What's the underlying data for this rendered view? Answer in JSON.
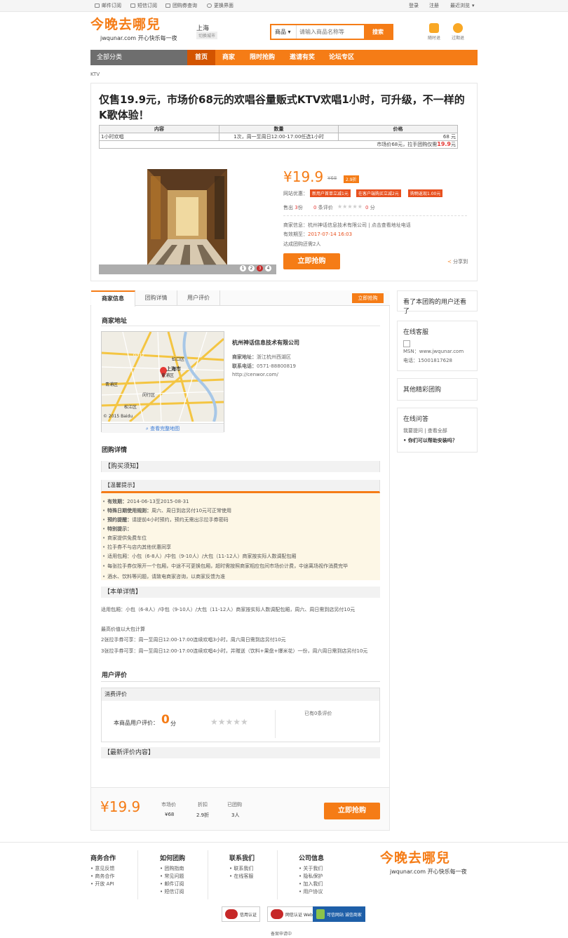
{
  "topbar": {
    "left": [
      "邮件订阅",
      "短信订阅",
      "团购券查询",
      "更换界面"
    ],
    "right": [
      "登录",
      "注册",
      "最近浏览"
    ]
  },
  "header": {
    "logo": "今晚去哪兒",
    "logo_sub": "jwqunar.com 开心快乐每一夜",
    "city": "上海",
    "switch_city": "切换城市",
    "search_select": "商品",
    "search_placeholder": "请输入商品名称等",
    "search_button": "搜索",
    "icon1": "随时退",
    "icon2": "过期退"
  },
  "nav": {
    "all": "全部分类",
    "items": [
      "首页",
      "商家",
      "限时抢购",
      "邀请有奖",
      "论坛专区"
    ]
  },
  "breadcrumb": "KTV",
  "deal": {
    "title": "仅售19.9元，市场价68元的欢唱谷量贩式KTV欢唱1小时，可升级，不一样的K歌体验！",
    "table": {
      "headers": [
        "内容",
        "数量",
        "价格"
      ],
      "row": [
        "1小时欢唱",
        "1次，周一至周日12:00-17:00任选1小时",
        "68 元"
      ],
      "summary_prefix": "市场价68元，拉手团购仅需",
      "summary_price": "19.9",
      "summary_unit": "元"
    },
    "slides": [
      "1",
      "2",
      "3",
      "4"
    ],
    "price": "¥19.9",
    "orig_price": "¥68",
    "discount": "2.9折",
    "promo_label": "网站优惠：",
    "promos": [
      "新用户首单立减1元",
      "在客户端购买立减2元",
      "购物返现1.00元"
    ],
    "sold_label": "售出",
    "sold": "3",
    "sold_unit": "份",
    "reviews": "0",
    "reviews_label": "条评价",
    "score": "0",
    "score_unit": "分",
    "merchant_label": "商家信息：",
    "merchant": "杭州神话信息技术有限公司 | 点击查看地址电话",
    "expire_label": "有效期至：",
    "expire": "2017-07-14 16:03",
    "reach": "达成团购还需2人",
    "buy": "立即抢购",
    "share": "分享到"
  },
  "tabs": [
    "商家信息",
    "团购详情",
    "用户评价"
  ],
  "tab_buy": "立即抢购",
  "merchant": {
    "section": "商家地址",
    "name": "杭州神话信息技术有限公司",
    "addr_label": "商家地址：",
    "addr": "浙江杭州西湖区",
    "tel_label": "联系电话：",
    "tel": "0571-88800819",
    "url": "http://cenwor.com/",
    "map_link": "查看完整地图",
    "map_copy": "© 2015 Baidu",
    "map_labels": [
      "虹口区",
      "上海市",
      "黄浦区",
      "青浦区",
      "闵行区",
      "松江区",
      "G312"
    ]
  },
  "details": {
    "section": "团购详情",
    "buy_notice": "【购买须知】",
    "tip": "【温馨提示】",
    "items": [
      [
        "有效期：",
        "2014-06-13至2015-08-31"
      ],
      [
        "特殊日期使用规则：",
        "周六、周日到店另付10元可正常使用"
      ],
      [
        "预约提醒：",
        "请提前4小时预约，预约无需出示拉手券密码"
      ],
      [
        "特别提示：",
        ""
      ],
      [
        "",
        "商家提供免费车位"
      ],
      [
        "",
        "拉手券不与店内其他优惠同享"
      ],
      [
        "",
        "适用包厢：小包（6-8人）/中包（9-10人）/大包（11-12人）商家按实际人数调配包厢"
      ],
      [
        "",
        "每张拉手券仅限开一个包厢，中途不可更换包厢，超时需按照商家相应包间市场价计费，中途离场视作消费完毕"
      ],
      [
        "",
        "酒水、饮料等问题，请致电商家咨询，以商家反馈为准"
      ]
    ],
    "bill": "【本单详情】",
    "bill_lines": [
      "适用包厢：小包（6-8人）/中包（9-10人）/大包（11-12人）商家按实际人数调配包厢，周六、周日需到店另付10元",
      "最高价值以大包计算",
      "2张拉手券可享：周一至周日12:00-17:00连续欢唱3小时，周六周日需到店另付10元",
      "3张拉手券可享：周一至周日12:00-17:00连续欢唱4小时，并赠送（饮料+果盘+爆米花）一份，周六周日需到店另付10元"
    ]
  },
  "review": {
    "section": "用户评价",
    "box": "消费评价",
    "label": "本商品用户评价：",
    "score": "0",
    "unit": "分",
    "count": "已有0条评价",
    "latest": "【最新评价内容】"
  },
  "bottom": {
    "price": "¥19.9",
    "cols": [
      [
        "市场价",
        "¥68"
      ],
      [
        "折扣",
        "2.9折"
      ],
      [
        "已团购",
        "3人"
      ]
    ],
    "buy": "立即抢购"
  },
  "side": {
    "also": "看了本团购的用户还看了",
    "service": "在线客服",
    "msn": "MSN：www.jwqunar.com",
    "phone": "电话：15001817628",
    "other": "其他精彩团购",
    "qa": "在线问答",
    "qa_links": "我要提问 | 查看全部",
    "qa_item": "你们可以帮助安装吗？"
  },
  "footer": {
    "cols": [
      {
        "title": "商务合作",
        "items": [
          "意见反馈",
          "商务合作",
          "开放 API"
        ]
      },
      {
        "title": "如何团购",
        "items": [
          "团购指南",
          "常见问题",
          "邮件订阅",
          "短信订阅"
        ]
      },
      {
        "title": "联系我们",
        "items": [
          "联系我们",
          "在线客服"
        ]
      },
      {
        "title": "公司信息",
        "items": [
          "关于我们",
          "隐私保护",
          "加入我们",
          "用户协议"
        ]
      }
    ],
    "badges": [
      "信用认证",
      "网信认证 Web Trust",
      "可信网站 诚信商家"
    ],
    "icp": "备案申请中"
  },
  "colors": {
    "accent": "#f57c16",
    "price_red": "#e53935"
  }
}
